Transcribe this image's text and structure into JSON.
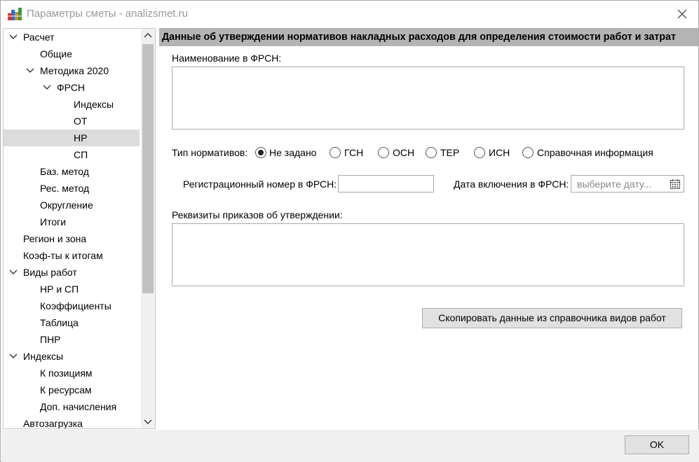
{
  "window": {
    "title": "Параметры сметы - analizsmet.ru"
  },
  "tree": {
    "items": [
      {
        "label": "Расчет",
        "level": 0,
        "expanded": true
      },
      {
        "label": "Общие",
        "level": 1
      },
      {
        "label": "Методика 2020",
        "level": 1,
        "expanded": true
      },
      {
        "label": "ФРСН",
        "level": 2,
        "expanded": true
      },
      {
        "label": "Индексы",
        "level": 3
      },
      {
        "label": "ОТ",
        "level": 3
      },
      {
        "label": "НР",
        "level": 3,
        "selected": true
      },
      {
        "label": "СП",
        "level": 3
      },
      {
        "label": "Баз. метод",
        "level": 1
      },
      {
        "label": "Рес. метод",
        "level": 1
      },
      {
        "label": "Округление",
        "level": 1
      },
      {
        "label": "Итоги",
        "level": 1
      },
      {
        "label": "Регион и зона",
        "level": 0
      },
      {
        "label": "Коэф-ты к итогам",
        "level": 0
      },
      {
        "label": "Виды работ",
        "level": 0,
        "expanded": true
      },
      {
        "label": "НР и СП",
        "level": 1
      },
      {
        "label": "Коэффициенты",
        "level": 1
      },
      {
        "label": "Таблица",
        "level": 1
      },
      {
        "label": "ПНР",
        "level": 1
      },
      {
        "label": "Индексы",
        "level": 0,
        "expanded": true
      },
      {
        "label": "К позициям",
        "level": 1
      },
      {
        "label": "К ресурсам",
        "level": 1
      },
      {
        "label": "Доп. начисления",
        "level": 1
      },
      {
        "label": "Автозагрузка",
        "level": 0
      }
    ]
  },
  "main": {
    "header": "Данные об утверждении нормативов накладных расходов для определения стоимости работ и затрат",
    "name_label": "Наименование в ФРСН:",
    "name_value": "",
    "norm_type_label": "Тип нормативов:",
    "norm_types": [
      {
        "label": "Не задано",
        "checked": true
      },
      {
        "label": "ГСН",
        "checked": false
      },
      {
        "label": "ОСН",
        "checked": false
      },
      {
        "label": "ТЕР",
        "checked": false
      },
      {
        "label": "ИСН",
        "checked": false
      },
      {
        "label": "Справочная информация",
        "checked": false
      }
    ],
    "reg_number_label": "Регистрационный номер в ФРСН:",
    "reg_number_value": "",
    "date_label": "Дата включения в ФРСН:",
    "date_placeholder": "выберите дату...",
    "requisites_label": "Реквизиты приказов об утверждении:",
    "requisites_value": "",
    "copy_button": "Скопировать данные из справочника видов работ"
  },
  "footer": {
    "ok_button": "OK"
  }
}
